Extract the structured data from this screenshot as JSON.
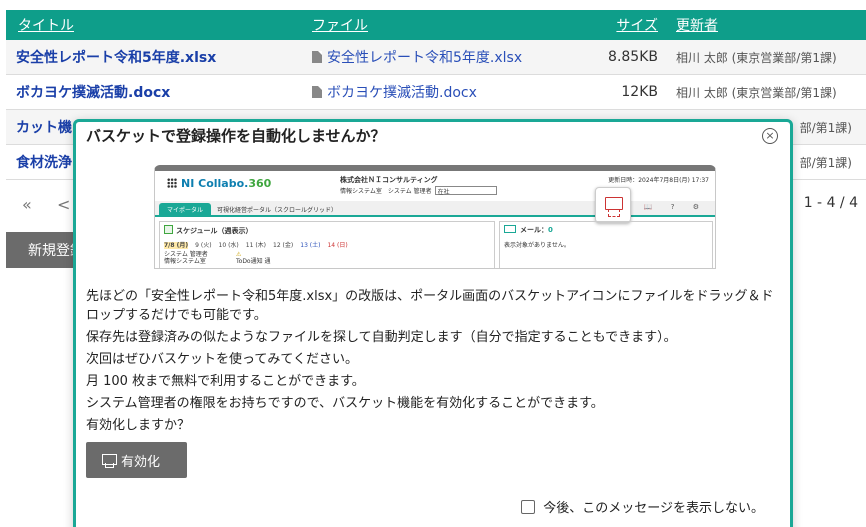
{
  "table": {
    "headers": {
      "title": "タイトル",
      "file": "ファイル",
      "size": "サイズ",
      "updater": "更新者"
    },
    "rows": [
      {
        "title": "安全性レポート令和5年度.xlsx",
        "file": "安全性レポート令和5年度.xlsx",
        "size": "8.85KB",
        "updater": "相川 太郎 (東京営業部/第1課)"
      },
      {
        "title": "ボカヨケ撲滅活動.docx",
        "file": "ボカヨケ撲滅活動.docx",
        "size": "12KB",
        "updater": "相川 太郎 (東京営業部/第1課)"
      },
      {
        "title": "カット機",
        "file": "",
        "size": "",
        "updater": "部/第1課)"
      },
      {
        "title": "食材洗浄",
        "file": "",
        "size": "",
        "updater": "部/第1課)"
      }
    ]
  },
  "pager": {
    "first": "«",
    "prev": "<",
    "count": "1 - 4 / 4"
  },
  "new_button": "新規登録",
  "modal": {
    "title": "バスケットで登録操作を自動化しませんか？",
    "close": "×",
    "body": [
      "先ほどの「安全性レポート令和5年度.xlsx」の改版は、ポータル画面のバスケットアイコンにファイルをドラッグ＆ドロップするだけでも可能です。",
      "保存先は登録済みの似たようなファイルを探して自動判定します（自分で指定することもできます）。",
      "次回はぜひバスケットを使ってみてください。",
      "月 100 枚まで無料で利用することができます。",
      "システム管理者の権限をお持ちですので、バスケット機能を有効化することができます。",
      "有効化しますか？"
    ],
    "enable_button": "有効化",
    "dont_show_label": "今後、このメッセージを表示しない。"
  },
  "preview": {
    "logo_a": "NI Collabo",
    "logo_b": "360",
    "company": "株式会社ＮＩコンサルティング",
    "dept": "情報システム室　システム 管理者",
    "select_value": "在社",
    "date": "更新日時：2024年7月8日(月) 17:37",
    "tools": "📖 ? ⚙",
    "tab_active": "マイポータル",
    "tab_other": "可視化経営ポータル（スクロールグリッド）",
    "schedule_title": "スケジュール（週表示）",
    "days": [
      {
        "label": "7/8 (月)",
        "kind": "today"
      },
      {
        "label": "9 (火)",
        "kind": ""
      },
      {
        "label": "10 (水)",
        "kind": ""
      },
      {
        "label": "11 (木)",
        "kind": ""
      },
      {
        "label": "12 (金)",
        "kind": ""
      },
      {
        "label": "13 (土)",
        "kind": "sat"
      },
      {
        "label": "14 (日)",
        "kind": "sun"
      }
    ],
    "user_line1": "システム 管理者",
    "user_line2": "情報システム室",
    "todo_mark": "⚠",
    "todo_text": "ToDo通知 通",
    "mail_title": "メール：",
    "mail_count": "0",
    "mail_empty": "表示対象がありません。"
  },
  "colors": {
    "accent": "#1aa896",
    "header_bg": "#0e9e8a",
    "button_gray": "#6b6b6b",
    "link": "#1a3fa8"
  }
}
